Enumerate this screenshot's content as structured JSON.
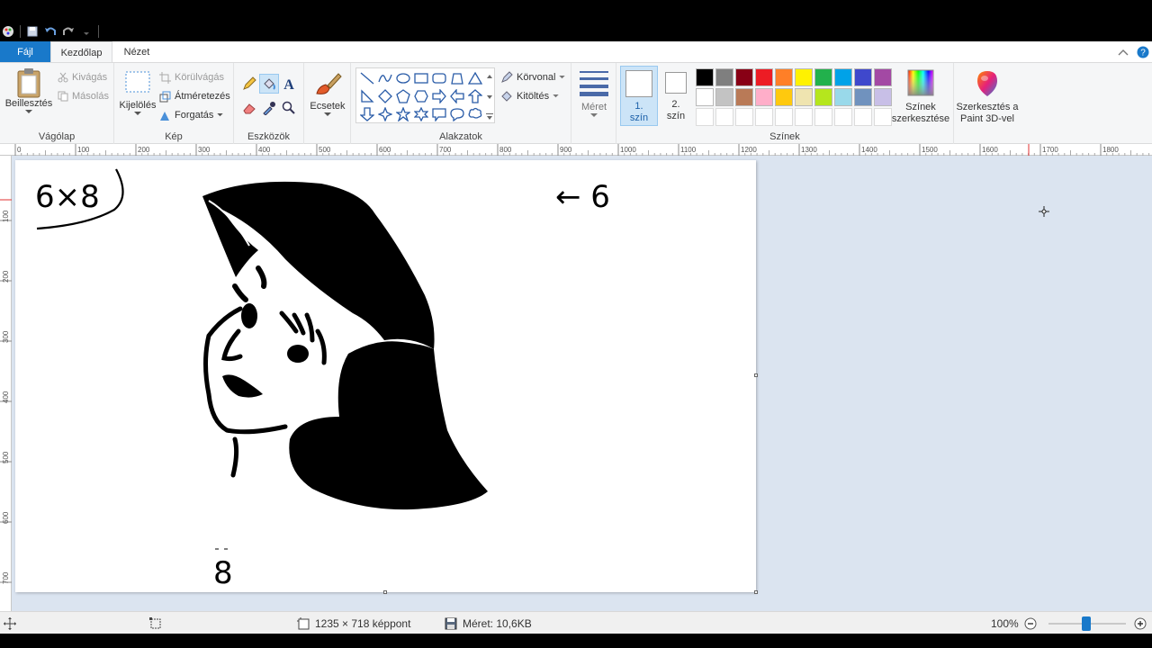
{
  "tabs": {
    "file": "Fájl",
    "home": "Kezdőlap",
    "view": "Nézet"
  },
  "clipboard": {
    "group": "Vágólap",
    "paste": "Beillesztés",
    "cut": "Kivágás",
    "copy": "Másolás"
  },
  "image": {
    "group": "Kép",
    "select": "Kijelölés",
    "crop": "Körülvágás",
    "resize": "Átméretezés",
    "rotate": "Forgatás"
  },
  "tools": {
    "group": "Eszközök"
  },
  "brushes": {
    "label": "Ecsetek"
  },
  "shapes": {
    "group": "Alakzatok",
    "outline": "Körvonal",
    "fill": "Kitöltés"
  },
  "size": {
    "label": "Méret"
  },
  "colors": {
    "group": "Színek",
    "color1": "1.\nszín",
    "color1_a": "1.",
    "color1_b": "szín",
    "color2_a": "2.",
    "color2_b": "szín",
    "edit_a": "Színek",
    "edit_b": "szerkesztése",
    "paint3d_a": "Szerkesztés a",
    "paint3d_b": "Paint 3D-vel",
    "palette_row1": [
      "#000000",
      "#7f7f7f",
      "#880015",
      "#ed1c24",
      "#ff7f27",
      "#fff200",
      "#22b14c",
      "#00a2e8",
      "#3f48cc",
      "#a349a4"
    ],
    "palette_row2": [
      "#ffffff",
      "#c3c3c3",
      "#b97a57",
      "#ffaec9",
      "#ffc90e",
      "#efe4b0",
      "#b5e61d",
      "#99d9ea",
      "#7092be",
      "#c8bfe7"
    ],
    "primary": "#ffffff",
    "secondary": "#ffffff"
  },
  "ruler": {
    "h_ticks": [
      "0",
      "100",
      "200",
      "300",
      "400",
      "500",
      "600",
      "700",
      "800",
      "900",
      "1000",
      "1100",
      "1200",
      "1300",
      "1400",
      "1500",
      "1600",
      "1700",
      "1800"
    ],
    "v_ticks": [
      "100",
      "200",
      "300",
      "400",
      "500",
      "600",
      "700"
    ]
  },
  "canvas_text": {
    "top_left": "6×8",
    "right": "← 6",
    "bottom": "8"
  },
  "status": {
    "dimensions": "1235 × 718 képpont",
    "file_size": "Méret: 10,6KB",
    "zoom": "100%"
  }
}
